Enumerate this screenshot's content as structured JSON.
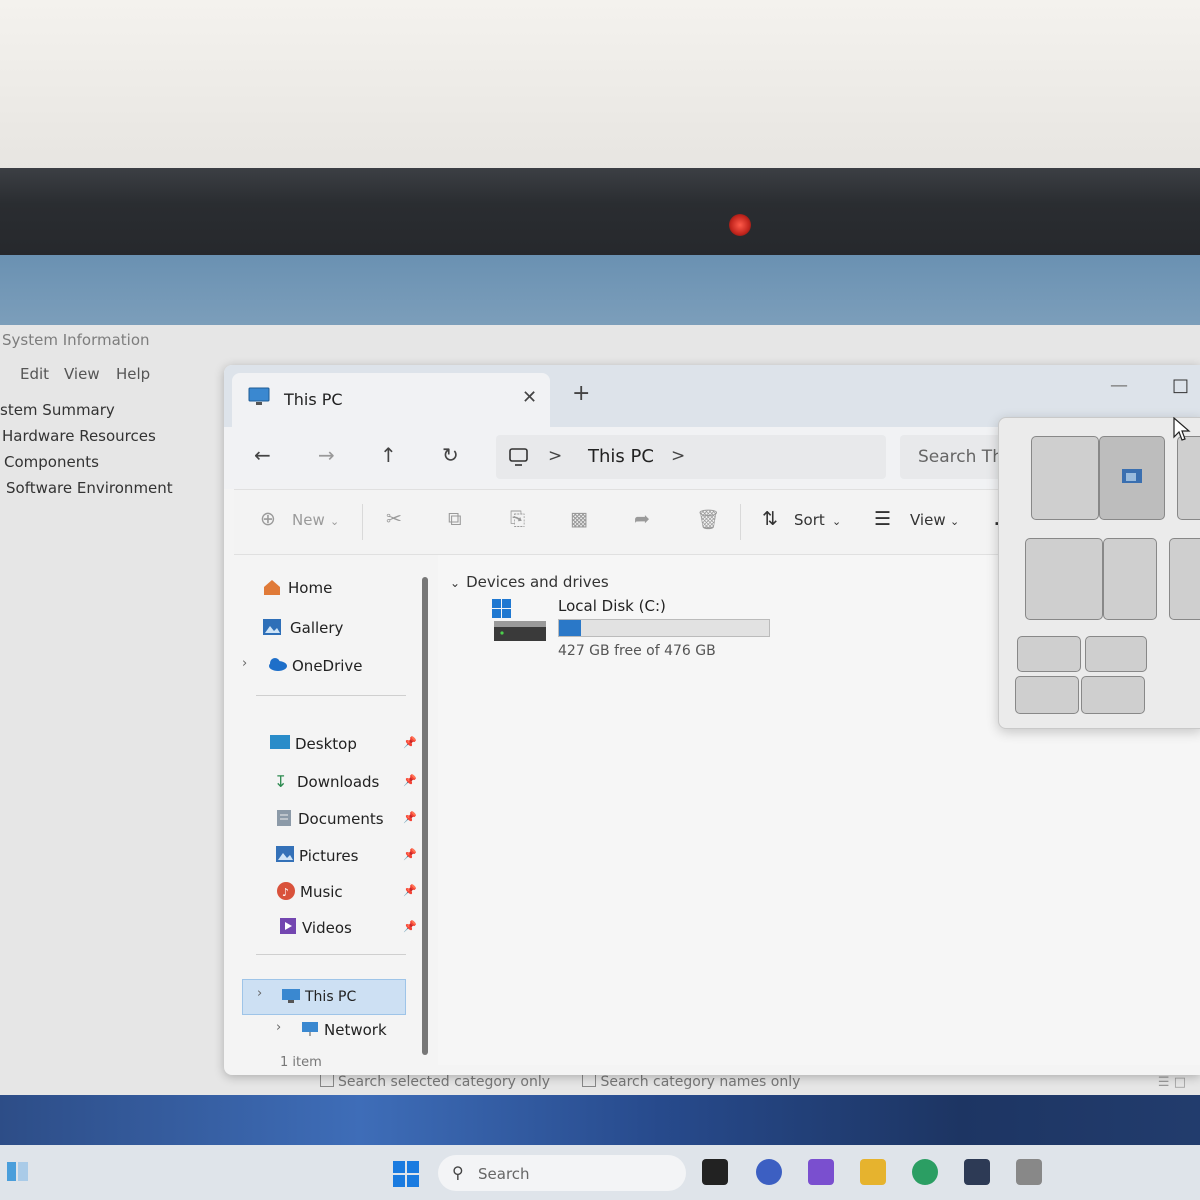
{
  "sysinfo": {
    "title": "System Information",
    "menu": [
      "Edit",
      "View",
      "Help"
    ],
    "tree": [
      "stem Summary",
      "Hardware Resources",
      "Components",
      "Software Environment"
    ],
    "options": [
      "Search selected category only",
      "Search category names only"
    ]
  },
  "explorer": {
    "tab_title": "This PC",
    "new_tab": "+",
    "address": {
      "separator": ">",
      "location": "This PC"
    },
    "search_placeholder": "Search This",
    "toolbar": {
      "new": "New",
      "sort": "Sort",
      "view": "View",
      "more": "..."
    },
    "nav": {
      "top": [
        "Home",
        "Gallery",
        "OneDrive"
      ],
      "pinned": [
        "Desktop",
        "Downloads",
        "Documents",
        "Pictures",
        "Music",
        "Videos"
      ],
      "bottom": [
        "This PC",
        "Network"
      ]
    },
    "group_header": "Devices and drives",
    "drive": {
      "name": "Local Disk (C:)",
      "free_text": "427 GB free of 476 GB",
      "used_fraction": 0.103
    },
    "status": "1 item"
  },
  "taskbar": {
    "search": "Search"
  },
  "colors": {
    "accent": "#2a78c8",
    "selection": "#cde0f3"
  }
}
